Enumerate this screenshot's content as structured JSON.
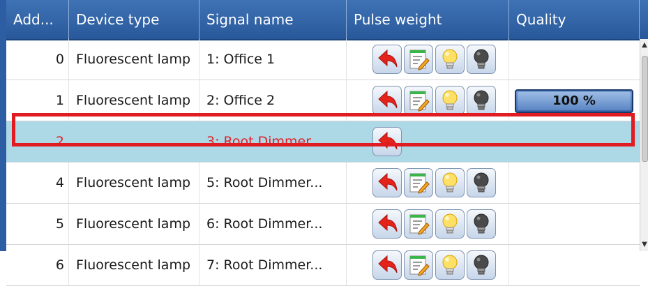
{
  "columns": [
    "Add...",
    "Device type",
    "Signal name",
    "Pulse weight",
    "Quality"
  ],
  "rows": [
    {
      "address": "0",
      "device_type": "Fluorescent lamp",
      "signal_name": "1: Office 1",
      "full_buttons": true,
      "selected": false,
      "quality": ""
    },
    {
      "address": "1",
      "device_type": "Fluorescent lamp",
      "signal_name": "2: Office 2",
      "full_buttons": true,
      "selected": false,
      "quality": "100 %"
    },
    {
      "address": "2",
      "device_type": "",
      "signal_name": "3: Root Dimmer...",
      "full_buttons": false,
      "selected": true,
      "quality": ""
    },
    {
      "address": "4",
      "device_type": "Fluorescent lamp",
      "signal_name": "5: Root Dimmer...",
      "full_buttons": true,
      "selected": false,
      "quality": ""
    },
    {
      "address": "5",
      "device_type": "Fluorescent lamp",
      "signal_name": "6: Root Dimmer...",
      "full_buttons": true,
      "selected": false,
      "quality": ""
    },
    {
      "address": "6",
      "device_type": "Fluorescent lamp",
      "signal_name": "7: Root Dimmer...",
      "full_buttons": true,
      "selected": false,
      "quality": ""
    }
  ],
  "buttons": [
    {
      "name": "undo-arrow-icon"
    },
    {
      "name": "edit-note-icon"
    },
    {
      "name": "bulb-on-icon"
    },
    {
      "name": "bulb-off-icon"
    }
  ],
  "colors": {
    "header": "#28589a",
    "selected_row": "#add8e6",
    "selected_text": "#e0242a",
    "highlight_box": "#e11b22"
  }
}
